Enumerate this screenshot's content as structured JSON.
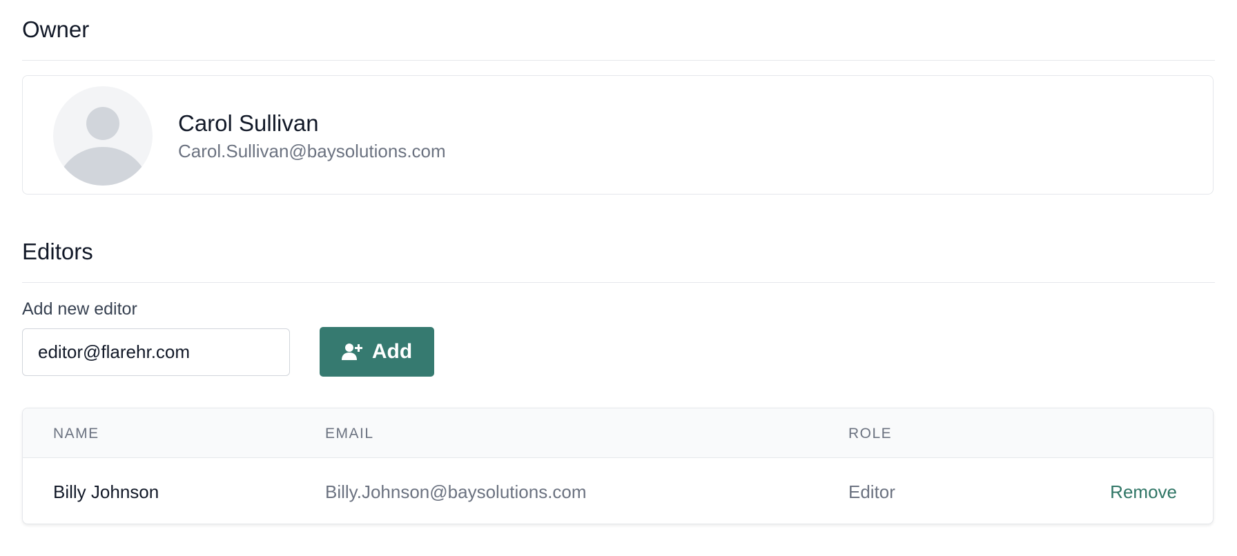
{
  "owner": {
    "section_title": "Owner",
    "name": "Carol Sullivan",
    "email": "Carol.Sullivan@baysolutions.com",
    "avatar_icon": "user-placeholder-icon"
  },
  "editors": {
    "section_title": "Editors",
    "add_label": "Add new editor",
    "input_value": "editor@flarehr.com",
    "add_button_label": "Add",
    "add_button_icon": "user-plus-icon",
    "table": {
      "columns": [
        "NAME",
        "EMAIL",
        "ROLE"
      ],
      "rows": [
        {
          "name": "Billy Johnson",
          "email": "Billy.Johnson@baysolutions.com",
          "role": "Editor",
          "action": "Remove"
        }
      ]
    }
  },
  "colors": {
    "accent": "#367a70",
    "link": "#2f7565",
    "text_primary": "#111827",
    "text_muted": "#6b7280",
    "border": "#e5e7eb"
  }
}
